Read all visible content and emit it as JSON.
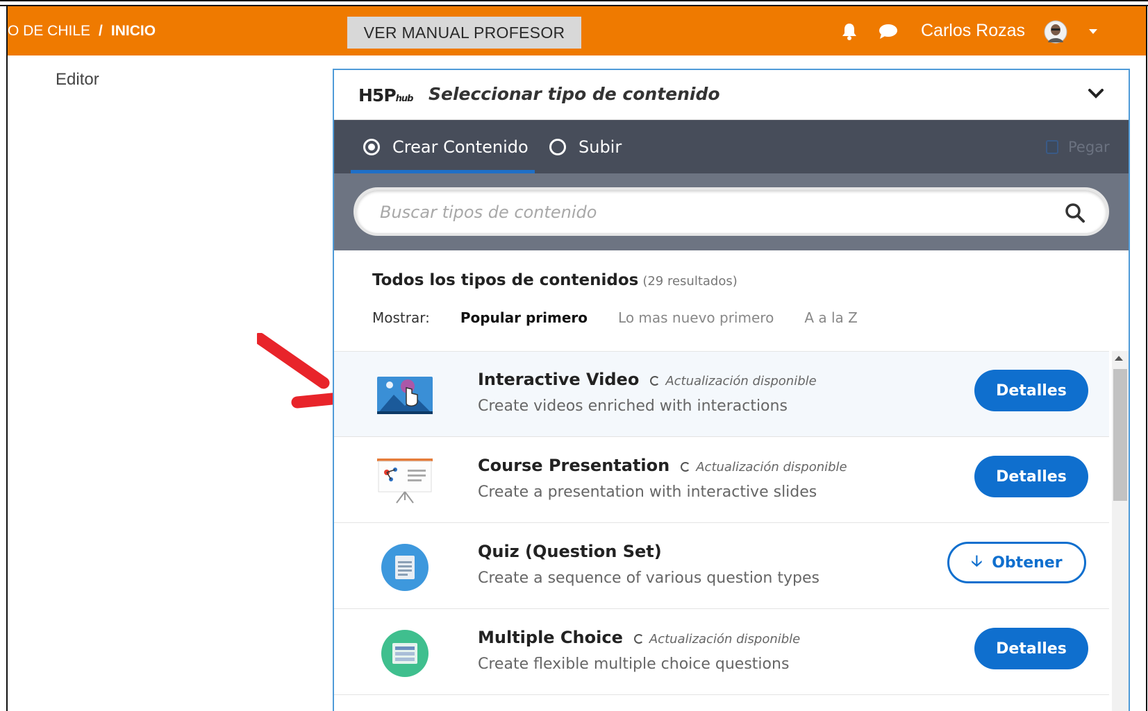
{
  "header": {
    "breadcrumb_prefix": "O DE CHILE",
    "breadcrumb_sep": "/",
    "breadcrumb_home": "INICIO",
    "manual_button": "VER MANUAL PROFESOR",
    "user_name": "Carlos Rozas",
    "brand_color": "#ef7a00"
  },
  "sidebar": {
    "label": "Editor"
  },
  "hub": {
    "logo_main": "H5P",
    "logo_sub": "hub",
    "title": "Seleccionar tipo de contenido",
    "tabs": [
      {
        "label": "Crear Contenido",
        "selected": true
      },
      {
        "label": "Subir",
        "selected": false
      }
    ],
    "paste_label": "Pegar",
    "search_placeholder": "Buscar tipos de contenido",
    "results_title": "Todos los tipos de contenidos",
    "results_count": "(29 resultados)",
    "sort": {
      "label": "Mostrar:",
      "options": [
        "Popular primero",
        "Lo mas nuevo primero",
        "A a la Z"
      ],
      "active": "Popular primero"
    },
    "items": [
      {
        "name": "Interactive Video",
        "update": "Actualización disponible",
        "desc": "Create videos enriched with interactions",
        "button": "Detalles",
        "icon": "interactive-video-icon"
      },
      {
        "name": "Course Presentation",
        "update": "Actualización disponible",
        "desc": "Create a presentation with interactive slides",
        "button": "Detalles",
        "icon": "course-presentation-icon"
      },
      {
        "name": "Quiz (Question Set)",
        "update": "",
        "desc": "Create a sequence of various question types",
        "button": "Obtener",
        "icon": "quiz-icon"
      },
      {
        "name": "Multiple Choice",
        "update": "Actualización disponible",
        "desc": "Create flexible multiple choice questions",
        "button": "Detalles",
        "icon": "multiple-choice-icon"
      }
    ],
    "accent_color": "#0f6fce"
  }
}
